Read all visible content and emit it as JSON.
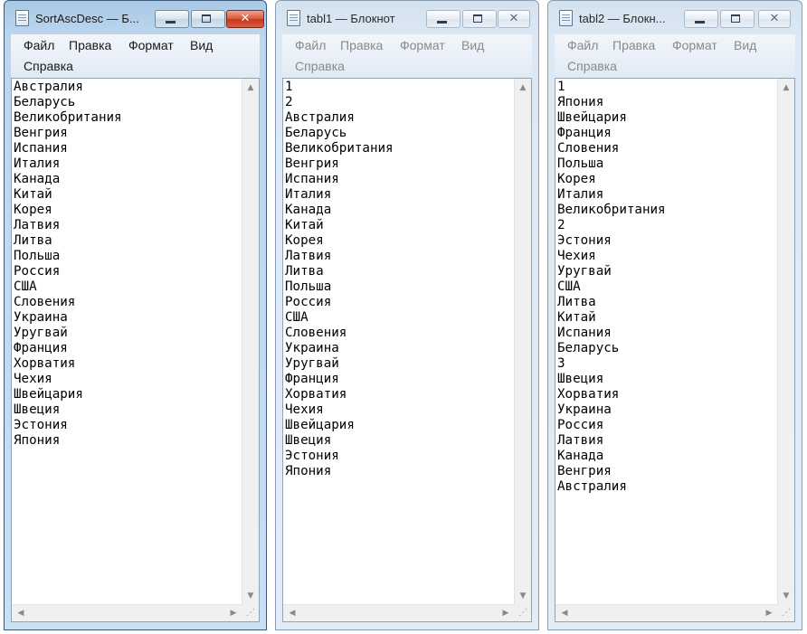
{
  "windows": [
    {
      "title": "SortAscDesc — Б...",
      "active": true,
      "menu": [
        "Файл",
        "Правка",
        "Формат",
        "Вид",
        "Справка"
      ],
      "lines": [
        "Австралия",
        "Беларусь",
        "Великобритания",
        "Венгрия",
        "Испания",
        "Италия",
        "Канада",
        "Китай",
        "Корея",
        "Латвия",
        "Литва",
        "Польша",
        "Россия",
        "США",
        "Словения",
        "Украина",
        "Уругвай",
        "Франция",
        "Хорватия",
        "Чехия",
        "Швейцария",
        "Швеция",
        "Эстония",
        "Япония"
      ]
    },
    {
      "title": "tabl1 — Блокнот",
      "active": false,
      "menu": [
        "Файл",
        "Правка",
        "Формат",
        "Вид",
        "Справка"
      ],
      "lines": [
        "1",
        "2",
        "Австралия",
        "Беларусь",
        "Великобритания",
        "Венгрия",
        "Испания",
        "Италия",
        "Канада",
        "Китай",
        "Корея",
        "Латвия",
        "Литва",
        "Польша",
        "Россия",
        "США",
        "Словения",
        "Украина",
        "Уругвай",
        "Франция",
        "Хорватия",
        "Чехия",
        "Швейцария",
        "Швеция",
        "Эстония",
        "Япония"
      ]
    },
    {
      "title": "tabl2 — Блокн...",
      "active": false,
      "menu": [
        "Файл",
        "Правка",
        "Формат",
        "Вид",
        "Справка"
      ],
      "lines": [
        "1",
        "Япония",
        "Швейцария",
        "Франция",
        "Словения",
        "Польша",
        "Корея",
        "Италия",
        "Великобритания",
        "2",
        "Эстония",
        "Чехия",
        "Уругвай",
        "США",
        "Литва",
        "Китай",
        "Испания",
        "Беларусь",
        "3",
        "Швеция",
        "Хорватия",
        "Украина",
        "Россия",
        "Латвия",
        "Канада",
        "Венгрия",
        "Австралия"
      ]
    }
  ],
  "icons": {
    "app": "notepad-icon",
    "minimize": "minimize-icon",
    "maximize": "maximize-icon",
    "close": "close-icon",
    "close_glyph": "✕",
    "scroll_up": "▲",
    "scroll_down": "▼",
    "scroll_left": "◀",
    "scroll_right": "▶",
    "grip": "⋰"
  },
  "colors": {
    "active_frame": "#bcd6ee",
    "inactive_frame": "#dce8f4",
    "close_button": "#d9563b"
  }
}
